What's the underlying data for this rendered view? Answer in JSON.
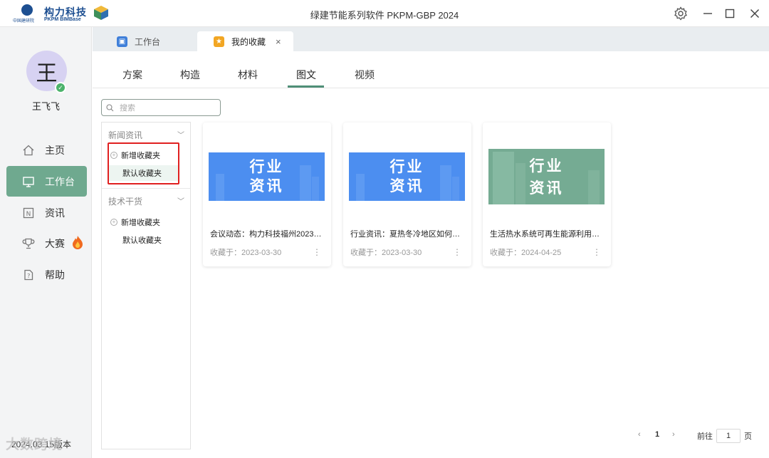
{
  "titlebar": {
    "logo_cn": "构力科技",
    "logo_sub1": "中国建研院",
    "logo_sub2": "PKPM BIMBase",
    "app_title": "绿建节能系列软件 PKPM-GBP 2024"
  },
  "user": {
    "avatar_char": "王",
    "name": "王飞飞"
  },
  "nav": {
    "home": "主页",
    "workbench": "工作台",
    "news": "资讯",
    "contest": "大赛",
    "help": "帮助"
  },
  "tabs": {
    "workbench": "工作台",
    "favorites": "我的收藏",
    "close": "×"
  },
  "categories": {
    "plan": "方案",
    "construction": "构造",
    "material": "材料",
    "article": "图文",
    "video": "视频",
    "active": "图文"
  },
  "search": {
    "placeholder": "搜索"
  },
  "folders": {
    "group1": {
      "title": "新闻资讯",
      "add": "新增收藏夹",
      "default": "默认收藏夹"
    },
    "group2": {
      "title": "技术干货",
      "add": "新增收藏夹",
      "default": "默认收藏夹"
    }
  },
  "cards": [
    {
      "img_line1": "行业",
      "img_line2": "资讯",
      "title": "会议动态：构力科技福州2023…",
      "date": "收藏于：2023-03-30"
    },
    {
      "img_line1": "行业",
      "img_line2": "资讯",
      "title": "行业资讯：夏热冬冷地区如何…",
      "date": "收藏于：2023-03-30"
    },
    {
      "img_line1": "行业",
      "img_line2": "资讯",
      "title": "生活热水系统可再生能源利用…",
      "date": "收藏于：2024-04-25"
    }
  ],
  "pagination": {
    "current": "1",
    "goto_label": "前往",
    "input_value": "1",
    "page_suffix": "页"
  },
  "footer": {
    "date_text": "2024.03.15版本",
    "watermark": "大数跨境"
  },
  "colors": {
    "accent": "#6fa98f",
    "card_blue": "#4c8ef0",
    "card_green": "#75ab93",
    "highlight": "#e02020"
  }
}
